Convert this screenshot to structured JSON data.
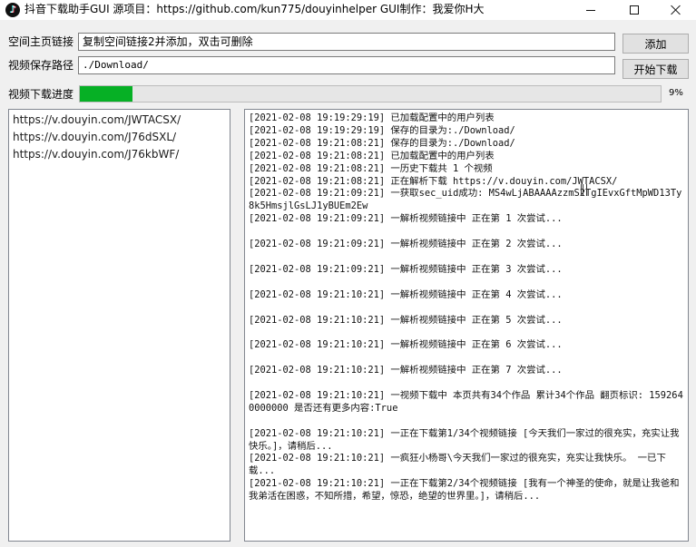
{
  "window": {
    "title": "抖音下载助手GUI 源项目：https://github.com/kun775/douyinhelper GUI制作：我爱你H大",
    "controls": {
      "minimize_icon": "minimize-icon",
      "maximize_icon": "maximize-icon",
      "close_icon": "close-icon"
    }
  },
  "form": {
    "homepage_label": "空间主页链接",
    "homepage_input_value": "复制空间链接2并添加，双击可删除",
    "add_button": "添加",
    "save_path_label": "视频保存路径",
    "save_path_value": "./Download/",
    "start_button": "开始下载"
  },
  "progress": {
    "label": "视频下载进度",
    "percent": 9,
    "percent_text": "9%",
    "fill_color": "#06b025"
  },
  "url_list": [
    "https://v.douyin.com/JWTACSX/",
    "https://v.douyin.com/J76dSXL/",
    "https://v.douyin.com/J76kbWF/"
  ],
  "log": [
    "[2021-02-08 19:19:29:19] 已加载配置中的用户列表",
    "[2021-02-08 19:19:29:19] 保存的目录为:./Download/",
    "[2021-02-08 19:21:08:21] 保存的目录为:./Download/",
    "[2021-02-08 19:21:08:21] 已加载配置中的用户列表",
    "[2021-02-08 19:21:08:21] 一历史下载共 1 个视频",
    "[2021-02-08 19:21:08:21] 正在解析下载 https://v.douyin.com/JWTACSX/",
    "[2021-02-08 19:21:09:21] 一获取sec_uid成功: MS4wLjABAAAAzzmS2TgIEvxGftMpWD13Ty8k5HmsjlGsLJ1yBUEm2Ew",
    "[2021-02-08 19:21:09:21] 一解析视频链接中 正在第 1 次尝试...",
    "",
    "[2021-02-08 19:21:09:21] 一解析视频链接中 正在第 2 次尝试...",
    "",
    "[2021-02-08 19:21:09:21] 一解析视频链接中 正在第 3 次尝试...",
    "",
    "[2021-02-08 19:21:10:21] 一解析视频链接中 正在第 4 次尝试...",
    "",
    "[2021-02-08 19:21:10:21] 一解析视频链接中 正在第 5 次尝试...",
    "",
    "[2021-02-08 19:21:10:21] 一解析视频链接中 正在第 6 次尝试...",
    "",
    "[2021-02-08 19:21:10:21] 一解析视频链接中 正在第 7 次尝试...",
    "",
    "[2021-02-08 19:21:10:21] 一视频下载中 本页共有34个作品 累计34个作品 翻页标识: 1592640000000 是否还有更多内容:True",
    "",
    "[2021-02-08 19:21:10:21] 一正在下载第1/34个视频链接 [今天我们一家过的很充实，充实让我快乐。]，请稍后...",
    "[2021-02-08 19:21:10:21] 一疯狂小杨哥\\今天我们一家过的很充实，充实让我快乐。 一已下载...",
    "[2021-02-08 19:21:10:21] 一正在下载第2/34个视频链接 [我有一个神圣的使命，就是让我爸和我弟活在困惑，不知所措，希望，惊恐，绝望的世界里。]，请稍后..."
  ]
}
